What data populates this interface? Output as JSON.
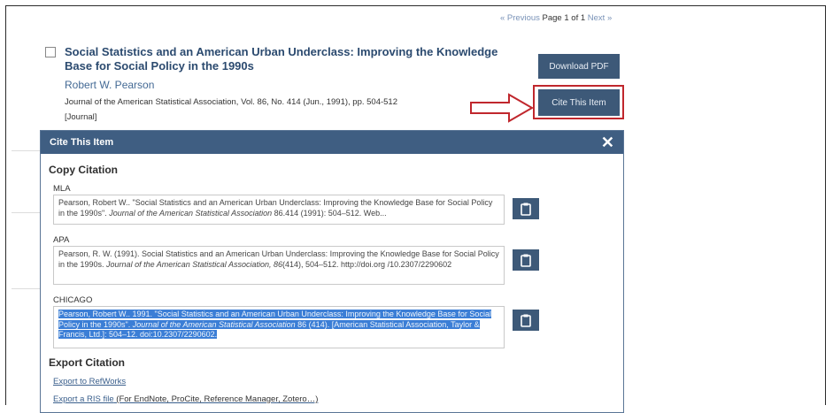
{
  "pager": {
    "previous": "« Previous",
    "page_text": "Page 1 of 1",
    "next": "Next »"
  },
  "result": {
    "title": "Social Statistics and an American Urban Underclass: Improving the Knowledge Base for Social Policy in the 1990s",
    "author": "Robert W. Pearson",
    "journal": "Journal of the American Statistical Association, Vol. 86, No. 414 (Jun., 1991), pp. 504-512",
    "type": "[Journal]",
    "download_pdf": "Download PDF",
    "cite_this_item": "Cite This Item"
  },
  "modal": {
    "title": "Cite This Item",
    "close": "✕",
    "copy_heading": "Copy Citation",
    "citations": [
      {
        "label": "MLA",
        "text_pre": "Pearson, Robert W.. \"Social Statistics and an American Urban Underclass: Improving the Knowledge Base for Social Policy in the 1990s\". ",
        "text_italic": "Journal of the American Statistical Association",
        "text_post": " 86.414 (1991): 504–512. Web..."
      },
      {
        "label": "APA",
        "text_pre": "Pearson, R. W. (1991). Social Statistics and an American Urban Underclass: Improving the Knowledge Base for Social Policy in the 1990s. ",
        "text_italic": "Journal of the American Statistical Association, 86",
        "text_post": "(414), 504–512. http://doi.org /10.2307/2290602"
      },
      {
        "label": "CHICAGO",
        "text_pre": "Pearson, Robert W.. 1991. \"Social Statistics and an American Urban Underclass: Improving the Knowledge Base for Social Policy in the 1990s\". ",
        "text_italic": "Journal of the American Statistical Association",
        "text_post": " 86 (414). [American Statistical Association, Taylor & Francis, Ltd.]: 504–12. doi:10.2307/2290602."
      }
    ],
    "export_heading": "Export Citation",
    "export_refworks": "Export to RefWorks",
    "export_ris": "Export a RIS file",
    "export_ris_note": " (For EndNote, ProCite, Reference Manager, Zotero…)"
  },
  "colors": {
    "accent": "#3f5e82",
    "button": "#3d5978",
    "highlight_outline": "#c0272d",
    "selection": "#3b7ed6"
  }
}
